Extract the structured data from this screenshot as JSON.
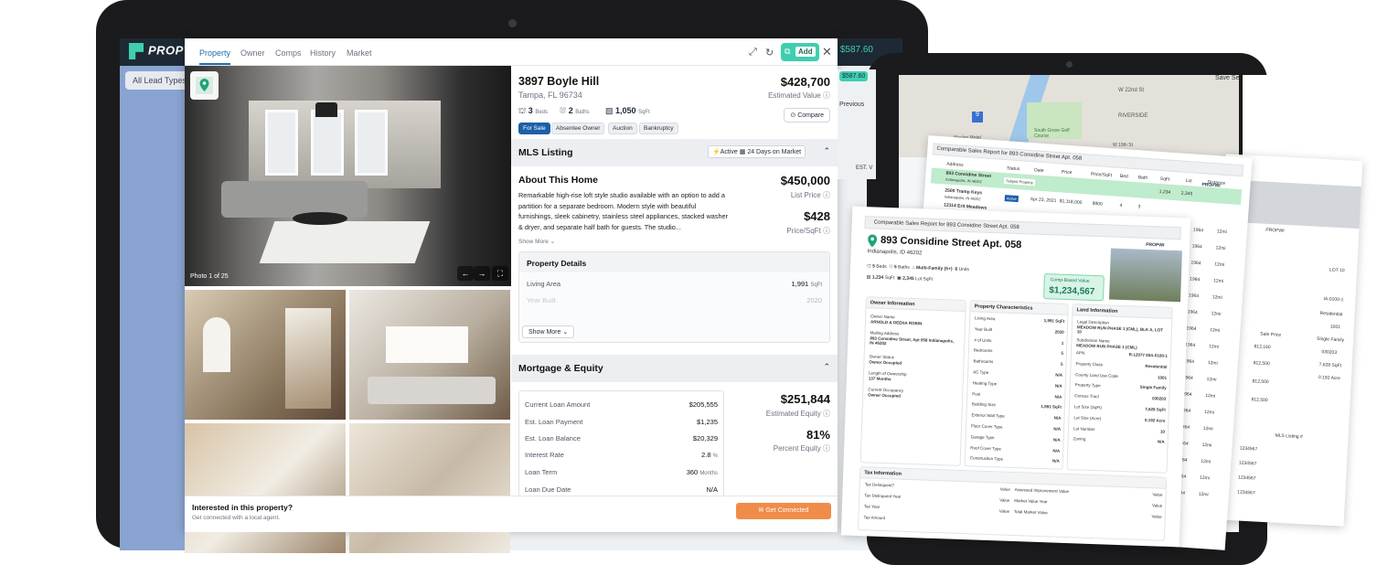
{
  "app": {
    "brand": "PROPWI",
    "balance": "$587.60",
    "filter_chip": "All Lead Types",
    "tabs": [
      "Property",
      "Owner",
      "Comps",
      "History",
      "Market"
    ],
    "add_label": "Add"
  },
  "listing": {
    "address": "3897 Boyle Hill",
    "city": "Tampa, FL 96734",
    "beds": "3",
    "beds_label": "Beds",
    "baths": "2",
    "baths_label": "Baths",
    "sqft": "1,050",
    "sqft_label": "SqFt",
    "price": "$428,700",
    "price_label": "Estimated Value",
    "compare_label": "Compare",
    "tags": [
      "For Sale",
      "Absentee Owner",
      "Auction",
      "Bankruptcy"
    ],
    "photo_caption": "Photo 1 of 25"
  },
  "mls": {
    "title": "MLS Listing",
    "status": "Active",
    "days": "24 Days on Market",
    "about_title": "About This Home",
    "description": "Remarkable high-rise loft style studio available with an option to add a partition for a separate bedroom. Modern style with beautiful furnishings, sleek cabinetry, stainless steel appliances, stacked washer & dryer, and separate half bath for guests. The studio...",
    "show_more": "Show More",
    "list_price": "$450,000",
    "list_price_label": "List Price",
    "ppsf": "$428",
    "ppsf_label": "Price/SqFt"
  },
  "property_details": {
    "title": "Property Details",
    "rows": [
      {
        "label": "Living Area",
        "value": "1,991",
        "unit": "SqFt"
      },
      {
        "label": "Year Built",
        "value": "2020",
        "unit": ""
      }
    ],
    "show_more": "Show More"
  },
  "mortgage": {
    "title": "Mortgage & Equity",
    "rows": [
      {
        "label": "Current Loan Amount",
        "value": "$205,555",
        "unit": ""
      },
      {
        "label": "Est. Loan Payment",
        "value": "$1,235",
        "unit": ""
      },
      {
        "label": "Est. Loan Balance",
        "value": "$20,329",
        "unit": ""
      },
      {
        "label": "Interest Rate",
        "value": "2.8",
        "unit": "%"
      },
      {
        "label": "Loan Term",
        "value": "360",
        "unit": "Months"
      },
      {
        "label": "Loan Due Date",
        "value": "N/A",
        "unit": ""
      }
    ],
    "equity": "$251,844",
    "equity_label": "Estimated Equity",
    "pct": "81%",
    "pct_label": "Percent Equity"
  },
  "footer": {
    "title": "Interested in this property?",
    "sub": "Get connected with a local agent.",
    "cta": "Get Connected"
  },
  "tablet": {
    "save_search": "Save Se",
    "previous": "Previous",
    "map_labels": [
      "W 22nd St",
      "RIVERSIDE",
      "South Grove Golf Course",
      "Maylan Motel",
      "W 19th St",
      "27th St"
    ],
    "est": "EST. V"
  },
  "report_back": {
    "title": "Comparable Sales Report for 893 Considine Street Apt. 058",
    "headers": [
      "Address",
      "Status",
      "Date",
      "Price",
      "Price/SqFt",
      "Bed",
      "Bath",
      "SqFt",
      "Lot",
      "Distance"
    ],
    "rows": [
      {
        "address": "893 Considine Street",
        "sub": "Indianapolis, IN 46202",
        "status": "Subject Property"
      },
      {
        "address": "2500 Tramp Keys",
        "sub": "Indianapolis, IN 46202",
        "status": "Active",
        "date": "Apr 23, 2021",
        "price": "$1,118,000",
        "ppsf": "$900",
        "bed": "4",
        "bath": "3"
      },
      {
        "address": "12114 Erit Meadows"
      }
    ],
    "dist": [
      "12mi",
      "12mi",
      "12mi",
      "12mi",
      "12mi",
      "12mi",
      "12mi",
      "12mi",
      "12mi",
      "12mi",
      "12mi",
      "12mi",
      "12mi",
      "12mi",
      "12mi",
      "12mi",
      "12mi",
      "12mi",
      "12mi",
      "12mi",
      "12mi",
      "12mi",
      "12mi",
      "12mi"
    ],
    "num": [
      "1,234",
      "2,345",
      "1964"
    ]
  },
  "report_front": {
    "title": "Comparable Sales Report for 893 Considine Street Apt. 058",
    "address": "893 Considine Street Apt. 058",
    "city": "Indianapolis, ID 46202",
    "beds": "5",
    "baths": "5",
    "type": "Multi-Family (5+)",
    "units": "6",
    "sqft": "1,234",
    "lot": "2,345",
    "comp_label": "Comp-Based Value",
    "comp_value": "$1,234,567",
    "owner": {
      "title": "Owner Information",
      "items": [
        {
          "label": "Owner Name",
          "value": "ARNOLD & DEENA ROBIN"
        },
        {
          "label": "Mailing Address",
          "value": "893 Considine Street, Apt 058 Indianapolis, IN 46202"
        },
        {
          "label": "Owner Status",
          "value": "Owner Occupied"
        },
        {
          "label": "Length of Ownership",
          "value": "137 Months"
        },
        {
          "label": "Current Occupancy",
          "value": "Owner Occupied"
        }
      ]
    },
    "chars": {
      "title": "Property Characteristics",
      "items": [
        [
          "Living Area",
          "1,991 SqFt"
        ],
        [
          "Year Built",
          "2020"
        ],
        [
          "# of Units",
          "1"
        ],
        [
          "Bedrooms",
          "5"
        ],
        [
          "Bathrooms",
          "5"
        ],
        [
          "AC Type",
          "N/A"
        ],
        [
          "Heating Type",
          "N/A"
        ],
        [
          "Pool",
          "N/A"
        ],
        [
          "Building Size",
          "1,991 SqFt"
        ],
        [
          "Exterior Wall Type",
          "N/A"
        ],
        [
          "Floor Cover Type",
          "N/A"
        ],
        [
          "Garage Type",
          "N/A"
        ],
        [
          "Roof Cover Type",
          "N/A"
        ],
        [
          "Construction Type",
          "N/A"
        ]
      ]
    },
    "land": {
      "title": "Land Information",
      "items": [
        [
          "Legal Description",
          "MEADOW RUN PHASE 1 (CML), BLK A, LOT 10"
        ],
        [
          "Subdivision Name",
          "MEADOW RUN PHASE 1 (CML)"
        ],
        [
          "APN",
          "R-12077 00A-0100-1"
        ],
        [
          "Property Class",
          "Residential"
        ],
        [
          "County Land Use Code",
          "1001"
        ],
        [
          "Property Type",
          "Single Family"
        ],
        [
          "Census Tract",
          "030203"
        ],
        [
          "Lot Size (SqFt)",
          "7,628 SqFt"
        ],
        [
          "Lot Size (Acre)",
          "0.192 Acre"
        ],
        [
          "Lot Number",
          "10"
        ],
        [
          "Zoning",
          "N/A"
        ]
      ]
    },
    "tax": {
      "title": "Tax Information",
      "items": [
        [
          "Tax Delinquent?",
          "Value",
          "Assessed Improvement Value",
          "Value"
        ],
        [
          "Tax Delinquent Year",
          "Value",
          "Market Value Year",
          "Value"
        ],
        [
          "Tax Year",
          "Value",
          "Total Market Value",
          "Value"
        ],
        [
          "Tax Amount",
          "",
          "",
          " "
        ]
      ]
    }
  },
  "report_right": {
    "lot": "LOT 10",
    "apn": "IA-0100-1",
    "class": "Residential",
    "code": "1001",
    "type": "Single Family",
    "tract": "030203",
    "size": "7,628 SqFt",
    "acre": "0.192 Acre",
    "prices": [
      "$12,160",
      "$12,500",
      "$12,500",
      "$12,500"
    ],
    "price_label": "Sale Price",
    "mls": "MLS Listing #",
    "ids": [
      "1234567",
      "1234567",
      "1234567",
      "1234567",
      "1234567",
      "1234567"
    ],
    "llc": "LLC"
  }
}
